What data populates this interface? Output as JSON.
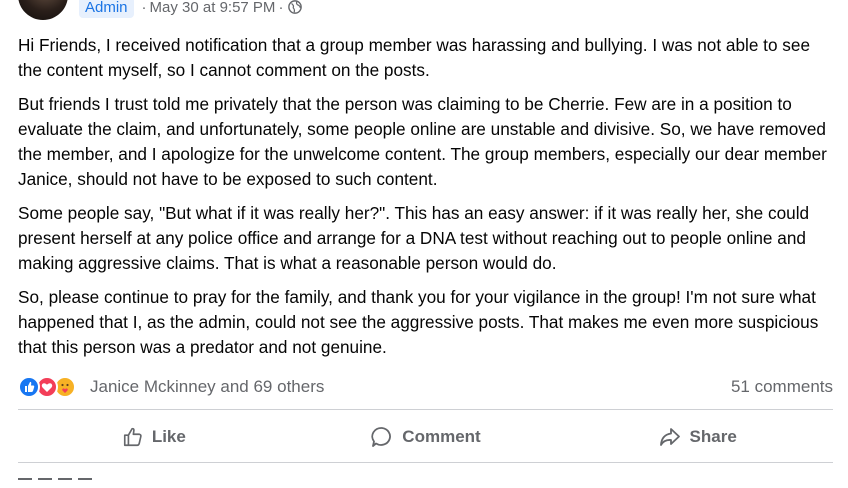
{
  "author": {
    "badge": "Admin",
    "timestamp": "May 30 at 9:57 PM",
    "separator": "·",
    "audience_icon": "globe-icon"
  },
  "post": {
    "paragraphs": [
      "Hi Friends, I received notification that a group member was harassing and bullying. I was not able to see the content myself, so I cannot comment on the posts.",
      "But friends I trust told me privately that the person was claiming to be Cherrie. Few are in a position to evaluate the claim, and unfortunately, some people online are unstable and divisive. So, we have removed the member, and I apologize for the unwelcome content. The group members, especially our dear member Janice, should not have to be exposed to such content.",
      "Some people say, \"But what if it was really her?\".  This has an easy answer: if it was really her, she could present herself at any police office and arrange for a DNA test without reaching out to people online and making aggressive claims. That is what a reasonable person would do.",
      "So, please continue to pray for the family, and thank you for your vigilance in the group! I'm not sure what happened that I, as the admin, could not see the aggressive posts. That makes me even more suspicious that this person was a predator and not genuine."
    ]
  },
  "reactions": {
    "icons": [
      "like-icon",
      "love-icon",
      "care-icon"
    ],
    "summary": "Janice Mckinney and 69 others",
    "comments": "51 comments"
  },
  "actions": {
    "like": "Like",
    "comment": "Comment",
    "share": "Share"
  },
  "colors": {
    "like": "#1877f2",
    "love": "#f33e58",
    "care": "#f7b125",
    "secondary_text": "#65676b",
    "admin_badge_bg": "#e7f0fd",
    "admin_badge_text": "#1b74e4"
  }
}
